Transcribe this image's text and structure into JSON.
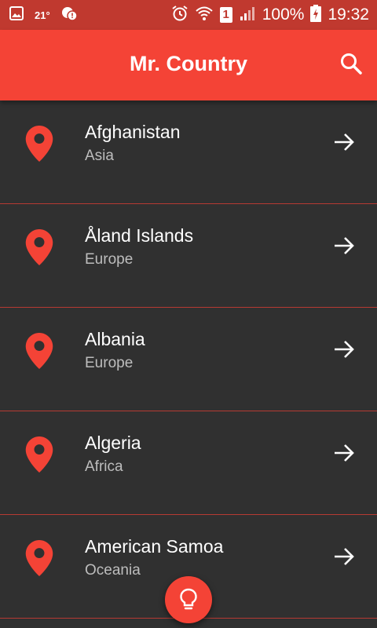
{
  "status_bar": {
    "temperature": "21°",
    "battery": "100%",
    "time": "19:32",
    "sim_slot": "1",
    "icons": [
      "image-icon",
      "weather-icon",
      "alarm-icon",
      "wifi-icon",
      "sim-icon",
      "signal-icon",
      "battery-charging-icon"
    ]
  },
  "app_bar": {
    "title": "Mr. Country",
    "search_icon": "search-icon"
  },
  "countries": [
    {
      "name": "Afghanistan",
      "region": "Asia"
    },
    {
      "name": "Åland Islands",
      "region": "Europe"
    },
    {
      "name": "Albania",
      "region": "Europe"
    },
    {
      "name": "Algeria",
      "region": "Africa"
    },
    {
      "name": "American Samoa",
      "region": "Oceania"
    }
  ],
  "fab": {
    "icon": "lightbulb-icon"
  },
  "colors": {
    "primary": "#f44336",
    "status_bar": "#c0392f",
    "background": "#303030",
    "divider": "#b63a33",
    "secondary_text": "#bdbdbd"
  }
}
